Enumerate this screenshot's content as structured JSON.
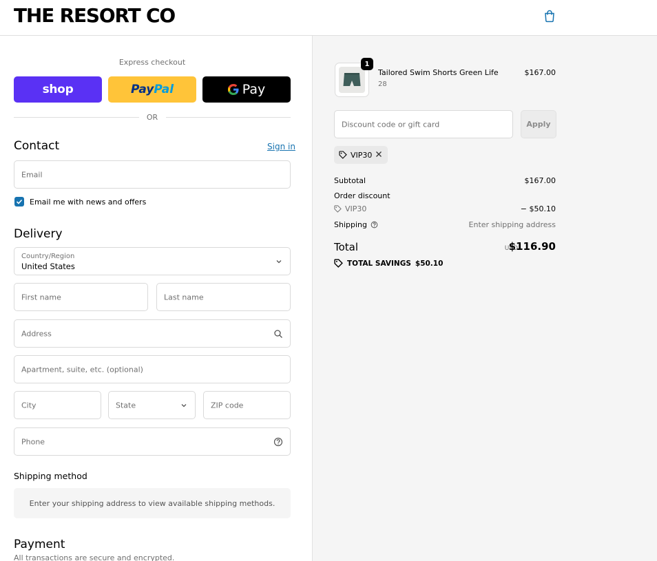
{
  "header": {
    "logo": "THE RESORT CO",
    "cart_icon": "shopping-bag-icon"
  },
  "express": {
    "label": "Express checkout",
    "shop_label": "shop",
    "paypal_label_1": "Pay",
    "paypal_label_2": "Pal",
    "gpay_g": "G",
    "gpay_label": "Pay",
    "or_label": "OR"
  },
  "contact": {
    "title": "Contact",
    "sign_in": "Sign in",
    "email_placeholder": "Email",
    "newsletter_label": "Email me with news and offers",
    "newsletter_checked": true
  },
  "delivery": {
    "title": "Delivery",
    "country_label": "Country/Region",
    "country_value": "United States",
    "first_name_placeholder": "First name",
    "last_name_placeholder": "Last name",
    "address_placeholder": "Address",
    "apartment_placeholder": "Apartment, suite, etc. (optional)",
    "city_placeholder": "City",
    "state_placeholder": "State",
    "zip_placeholder": "ZIP code",
    "phone_placeholder": "Phone"
  },
  "shipping_method": {
    "title": "Shipping method",
    "message": "Enter your shipping address to view available shipping methods."
  },
  "payment": {
    "title": "Payment",
    "subtitle": "All transactions are secure and encrypted."
  },
  "order": {
    "product_name": "Tailored Swim Shorts Green Life",
    "product_variant": "28",
    "product_price": "$167.00",
    "quantity": "1",
    "discount_placeholder": "Discount code or gift card",
    "apply_label": "Apply",
    "applied_code": "VIP30",
    "subtotal_label": "Subtotal",
    "subtotal_value": "$167.00",
    "order_discount_label": "Order discount",
    "discount_code": "VIP30",
    "discount_value": "− $50.10",
    "shipping_label": "Shipping",
    "shipping_value": "Enter shipping address",
    "total_label": "Total",
    "total_currency": "USD",
    "total_value": "$116.90",
    "savings_label": "TOTAL SAVINGS",
    "savings_value": "$50.10"
  },
  "colors": {
    "accent": "#1773b0",
    "shop_purple": "#5a31f4",
    "paypal_yellow": "#ffc439",
    "sidebar_bg": "#f5f5f5"
  }
}
